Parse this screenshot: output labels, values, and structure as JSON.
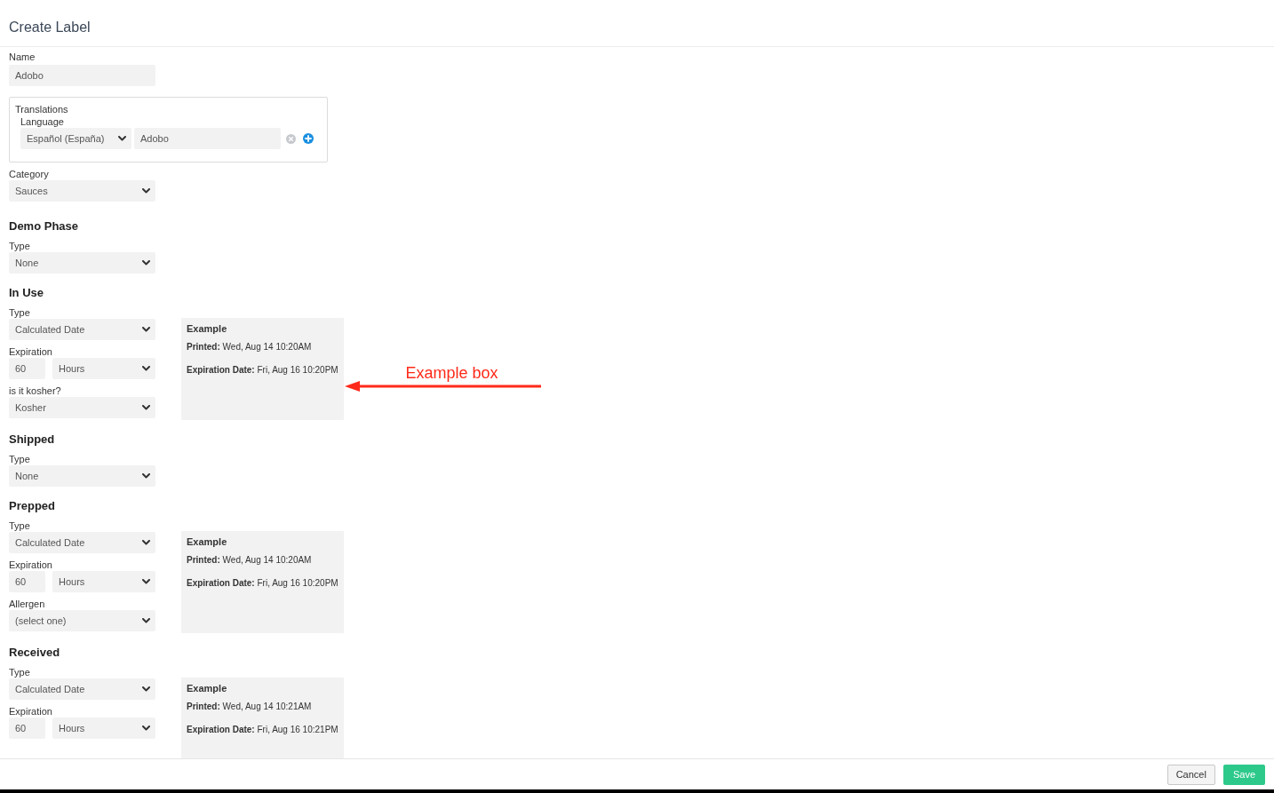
{
  "header": {
    "title": "Create Label"
  },
  "name_field": {
    "label": "Name",
    "value": "Adobo"
  },
  "translations": {
    "title": "Translations",
    "language_label": "Language",
    "rows": [
      {
        "language": "Español (España)",
        "value": "Adobo"
      }
    ]
  },
  "category": {
    "label": "Category",
    "value": "Sauces"
  },
  "sections": [
    {
      "title": "Demo Phase",
      "fields": [
        {
          "kind": "select",
          "label": "Type",
          "value": "None"
        }
      ]
    },
    {
      "title": "In Use",
      "fields": [
        {
          "kind": "select",
          "label": "Type",
          "value": "Calculated Date"
        },
        {
          "kind": "duration",
          "label": "Expiration",
          "amount": "60",
          "unit": "Hours"
        },
        {
          "kind": "select",
          "label": "is it kosher?",
          "value": "Kosher"
        }
      ],
      "example": {
        "title": "Example",
        "lines": [
          "**Printed:** Wed, Aug 14 10:20AM",
          "**Expiration Date:** Fri, Aug 16 10:20PM"
        ]
      },
      "annotation": {
        "text": "Example box"
      }
    },
    {
      "title": "Shipped",
      "fields": [
        {
          "kind": "select",
          "label": "Type",
          "value": "None"
        }
      ]
    },
    {
      "title": "Prepped",
      "fields": [
        {
          "kind": "select",
          "label": "Type",
          "value": "Calculated Date"
        },
        {
          "kind": "duration",
          "label": "Expiration",
          "amount": "60",
          "unit": "Hours"
        },
        {
          "kind": "select",
          "label": "Allergen",
          "value": "(select one)"
        }
      ],
      "example": {
        "title": "Example",
        "lines": [
          "**Printed:** Wed, Aug 14 10:20AM",
          "**Expiration Date:** Fri, Aug 16 10:20PM"
        ]
      }
    },
    {
      "title": "Received",
      "fields": [
        {
          "kind": "select",
          "label": "Type",
          "value": "Calculated Date"
        },
        {
          "kind": "duration",
          "label": "Expiration",
          "amount": "60",
          "unit": "Hours"
        }
      ],
      "example": {
        "title": "Example",
        "lines": [
          "**Printed:** Wed, Aug 14 10:21AM",
          "**Expiration Date:** Fri, Aug 16 10:21PM"
        ]
      }
    }
  ],
  "footer": {
    "buttons": [
      {
        "label": "Cancel",
        "kind": "secondary"
      },
      {
        "label": "Save",
        "kind": "primary"
      }
    ]
  }
}
